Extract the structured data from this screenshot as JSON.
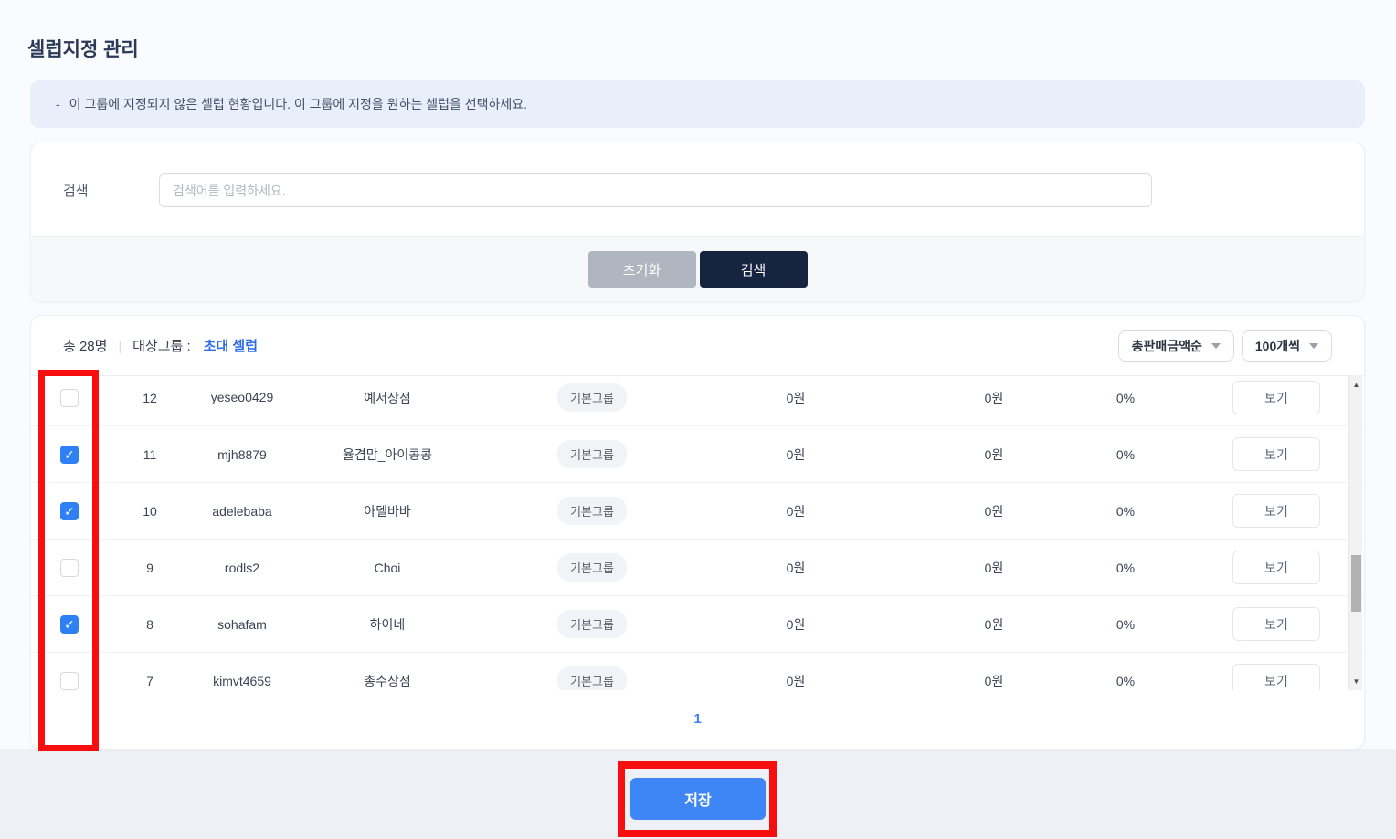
{
  "page": {
    "title": "셀럽지정 관리"
  },
  "notice": {
    "bullet": "-",
    "text": "이 그룹에 지정되지 않은 셀럽 현황입니다. 이 그룹에 지정을 원하는 셀럽을 선택하세요."
  },
  "search": {
    "label": "검색",
    "placeholder": "검색어를 입력하세요.",
    "value": "",
    "reset_label": "초기화",
    "submit_label": "검색"
  },
  "list": {
    "total_label": "총 28명",
    "separator": "|",
    "group_label": "대상그룹 :",
    "group_name": "초대 셀럽",
    "sort_select": "총판매금액순",
    "page_size_select": "100개씩",
    "view_label": "보기",
    "pagination_current": "1",
    "rows": [
      {
        "checked": false,
        "no": "12",
        "id": "yeseo0429",
        "name": "예서상점",
        "group": "기본그룹",
        "amount1": "0원",
        "amount2": "0원",
        "rate": "0%"
      },
      {
        "checked": true,
        "no": "11",
        "id": "mjh8879",
        "name": "율겸맘_아이콩콩",
        "group": "기본그룹",
        "amount1": "0원",
        "amount2": "0원",
        "rate": "0%"
      },
      {
        "checked": true,
        "no": "10",
        "id": "adelebaba",
        "name": "아델바바",
        "group": "기본그룹",
        "amount1": "0원",
        "amount2": "0원",
        "rate": "0%"
      },
      {
        "checked": false,
        "no": "9",
        "id": "rodls2",
        "name": "Choi",
        "group": "기본그룹",
        "amount1": "0원",
        "amount2": "0원",
        "rate": "0%"
      },
      {
        "checked": true,
        "no": "8",
        "id": "sohafam",
        "name": "하이네",
        "group": "기본그룹",
        "amount1": "0원",
        "amount2": "0원",
        "rate": "0%"
      },
      {
        "checked": false,
        "no": "7",
        "id": "kimvt4659",
        "name": "총수상점",
        "group": "기본그룹",
        "amount1": "0원",
        "amount2": "0원",
        "rate": "0%"
      }
    ]
  },
  "footer": {
    "save_label": "저장"
  },
  "colors": {
    "accent_blue": "#3e86f5",
    "checkbox_blue": "#2f80f5",
    "link_blue": "#2e6bea",
    "dark_navy_button": "#16243f",
    "gray_button": "#b0b6bf",
    "notice_bg": "#e8effb",
    "annotation_red": "#f70f0f"
  }
}
